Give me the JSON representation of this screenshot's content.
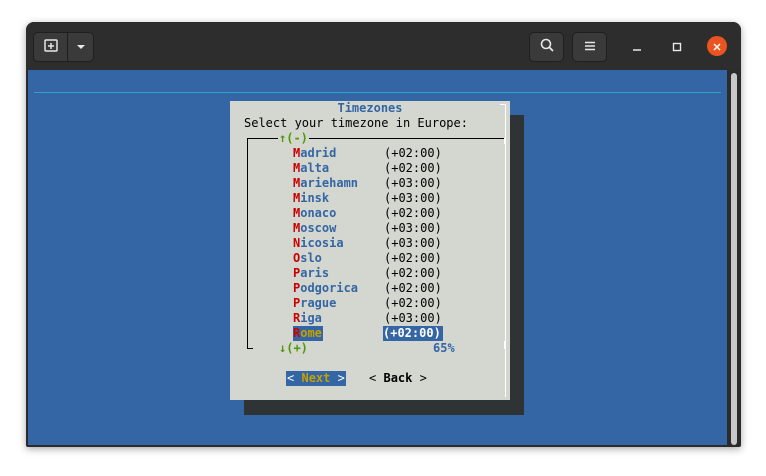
{
  "window": {
    "icons": {
      "new_tab": "new-tab-icon",
      "dropdown": "chevron-down-icon",
      "search": "search-icon",
      "menu": "hamburger-menu-icon",
      "minimize": "minimize-icon",
      "maximize": "maximize-icon",
      "close": "close-icon"
    },
    "close_color": "#e95420"
  },
  "terminal": {
    "background": "#3465a4"
  },
  "dialog": {
    "title": "Timezones",
    "prompt": "Select your timezone in Europe:",
    "scroll_up": "↑(-)",
    "scroll_down": "↓(+)",
    "percent": "65%",
    "items": [
      {
        "hotkey": "M",
        "rest": "adrid",
        "offset": "(+02:00)"
      },
      {
        "hotkey": "M",
        "rest": "alta",
        "offset": "(+02:00)"
      },
      {
        "hotkey": "M",
        "rest": "ariehamn",
        "offset": "(+03:00)"
      },
      {
        "hotkey": "M",
        "rest": "insk",
        "offset": "(+03:00)"
      },
      {
        "hotkey": "M",
        "rest": "onaco",
        "offset": "(+02:00)"
      },
      {
        "hotkey": "M",
        "rest": "oscow",
        "offset": "(+03:00)"
      },
      {
        "hotkey": "N",
        "rest": "icosia",
        "offset": "(+03:00)"
      },
      {
        "hotkey": "O",
        "rest": "slo",
        "offset": "(+02:00)"
      },
      {
        "hotkey": "P",
        "rest": "aris",
        "offset": "(+02:00)"
      },
      {
        "hotkey": "P",
        "rest": "odgorica",
        "offset": "(+02:00)"
      },
      {
        "hotkey": "P",
        "rest": "rague",
        "offset": "(+02:00)"
      },
      {
        "hotkey": "R",
        "rest": "iga",
        "offset": "(+03:00)"
      },
      {
        "hotkey": "R",
        "rest": "ome",
        "offset": "(+02:00)",
        "selected": true
      }
    ],
    "buttons": {
      "next": {
        "left": "<",
        "label": "Next",
        "right": ">"
      },
      "back": {
        "left": "<",
        "label": "Back",
        "right": ">"
      }
    }
  }
}
